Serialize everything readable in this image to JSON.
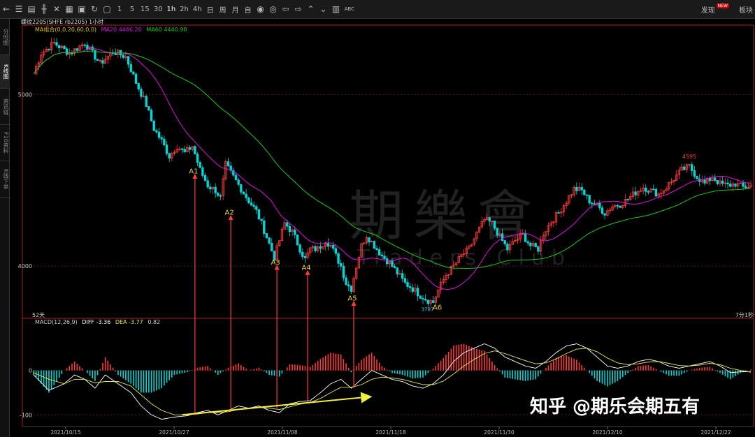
{
  "toolbar": {
    "items": [
      {
        "name": "back-icon",
        "glyph": "←"
      },
      {
        "name": "list-icon",
        "glyph": "☰"
      },
      {
        "name": "grid-icon",
        "glyph": "▤"
      },
      {
        "name": "kline-icon",
        "glyph": "╫"
      },
      {
        "name": "tools-icon",
        "glyph": "✕"
      },
      {
        "name": "calendar-icon",
        "glyph": "▦"
      },
      {
        "name": "save-icon",
        "glyph": "▣"
      },
      {
        "name": "refresh-icon",
        "glyph": "↻"
      },
      {
        "name": "copy-icon",
        "glyph": "▢"
      }
    ],
    "periods": [
      "1",
      "5",
      "15",
      "30",
      "1h",
      "2h",
      "4h",
      "日",
      "周",
      "月",
      "自"
    ],
    "tools": [
      {
        "name": "eye-icon",
        "glyph": "◉"
      },
      {
        "name": "eye-alt-icon",
        "glyph": "◎"
      },
      {
        "name": "arrow-left-icon",
        "glyph": "⇦"
      },
      {
        "name": "arrow-right-icon",
        "glyph": "⇨"
      },
      {
        "name": "chevron-up-icon",
        "glyph": "⌃"
      },
      {
        "name": "chevron-down-icon",
        "glyph": "⌄"
      },
      {
        "name": "layout-icon",
        "glyph": "▥"
      }
    ],
    "abc_label": "ABC",
    "discover_label": "发现",
    "new_badge": "NEW",
    "sector_label": "板块"
  },
  "sidebar": {
    "tabs": [
      "分时图",
      "K线图",
      "资讯链",
      "F10资料",
      "K线下单"
    ],
    "active": 1
  },
  "chart_header": {
    "symbol_line": "螺纹2205(SHFE rb2205) 1小时",
    "ma_label": "MA组合(0,0,20,60,0,0)",
    "ma20_label": "MA20 4466.20",
    "ma60_label": "MA60 4440.98"
  },
  "macd_header": {
    "label": "MACD(12,26,9)",
    "diff": "DIFF -3.36",
    "dea": "DEA -3.77",
    "macd": "0.82"
  },
  "markers": {
    "high_label": "4595",
    "low_label": "3787",
    "period_left": "52天",
    "countdown": "7分1秒"
  },
  "watermark": {
    "cn": "期樂會",
    "en": "Traders Club"
  },
  "footer": {
    "text": "知乎 @期乐会期五有"
  },
  "colors": {
    "up": "#ff3b3b",
    "down": "#00d8d8",
    "ma20": "#e010e0",
    "ma60": "#19c819",
    "diff": "#ffffff",
    "dea": "#e8e850",
    "annotation": "#f0d020",
    "arrow": "#ff3b3b",
    "trend": "#f0f040",
    "border": "#aa2222"
  },
  "chart_data": [
    {
      "type": "candlestick",
      "title": "螺纹2205(SHFE rb2205) 1小时",
      "ylim": [
        3700,
        5400
      ],
      "yticks": [
        4000,
        5000
      ],
      "xlabels": [
        "2021/10/15",
        "2021/10/27",
        "2021/11/08",
        "2021/11/18",
        "2021/11/30",
        "2021/12/10",
        "2021/12/22"
      ],
      "price_path": [
        [
          0,
          5120
        ],
        [
          3,
          5240
        ],
        [
          8,
          5300
        ],
        [
          14,
          5240
        ],
        [
          20,
          5300
        ],
        [
          26,
          5180
        ],
        [
          31,
          5250
        ],
        [
          36,
          5220
        ],
        [
          40,
          5070
        ],
        [
          44,
          4940
        ],
        [
          47,
          4800
        ],
        [
          50,
          4730
        ],
        [
          53,
          4640
        ],
        [
          56,
          4700
        ],
        [
          59,
          4660
        ],
        [
          62,
          4700
        ],
        [
          65,
          4560
        ],
        [
          68,
          4470
        ],
        [
          71,
          4440
        ],
        [
          73,
          4400
        ],
        [
          75,
          4590
        ],
        [
          78,
          4520
        ],
        [
          81,
          4450
        ],
        [
          84,
          4380
        ],
        [
          87,
          4320
        ],
        [
          90,
          4210
        ],
        [
          92,
          4130
        ],
        [
          94,
          4050
        ],
        [
          96,
          4150
        ],
        [
          98,
          4250
        ],
        [
          101,
          4200
        ],
        [
          104,
          4100
        ],
        [
          106,
          4040
        ],
        [
          108,
          4100
        ],
        [
          111,
          4100
        ],
        [
          114,
          4150
        ],
        [
          116,
          4120
        ],
        [
          118,
          4060
        ],
        [
          120,
          4000
        ],
        [
          122,
          3900
        ],
        [
          124,
          3870
        ],
        [
          126,
          4000
        ],
        [
          128,
          4120
        ],
        [
          130,
          4180
        ],
        [
          133,
          4120
        ],
        [
          136,
          4060
        ],
        [
          139,
          4020
        ],
        [
          142,
          3960
        ],
        [
          145,
          3900
        ],
        [
          148,
          3870
        ],
        [
          151,
          3830
        ],
        [
          154,
          3800
        ],
        [
          156,
          3790
        ],
        [
          158,
          3860
        ],
        [
          161,
          3950
        ],
        [
          164,
          4000
        ],
        [
          167,
          4060
        ],
        [
          170,
          4100
        ],
        [
          173,
          4190
        ],
        [
          176,
          4270
        ],
        [
          179,
          4250
        ],
        [
          182,
          4170
        ],
        [
          185,
          4100
        ],
        [
          188,
          4150
        ],
        [
          191,
          4180
        ],
        [
          194,
          4120
        ],
        [
          197,
          4100
        ],
        [
          199,
          4190
        ],
        [
          202,
          4260
        ],
        [
          205,
          4310
        ],
        [
          208,
          4380
        ],
        [
          211,
          4450
        ],
        [
          214,
          4440
        ],
        [
          217,
          4380
        ],
        [
          220,
          4350
        ],
        [
          223,
          4310
        ],
        [
          226,
          4350
        ],
        [
          229,
          4360
        ],
        [
          232,
          4390
        ],
        [
          235,
          4430
        ],
        [
          238,
          4460
        ],
        [
          241,
          4440
        ],
        [
          244,
          4420
        ],
        [
          247,
          4460
        ],
        [
          250,
          4510
        ],
        [
          253,
          4560
        ],
        [
          256,
          4580
        ],
        [
          259,
          4520
        ],
        [
          262,
          4480
        ],
        [
          265,
          4520
        ],
        [
          268,
          4480
        ],
        [
          271,
          4470
        ],
        [
          274,
          4480
        ],
        [
          277,
          4460
        ],
        [
          280,
          4470
        ]
      ],
      "annotations": [
        {
          "label": "A1",
          "x": 63,
          "price": 4580,
          "macd": -98
        },
        {
          "label": "A2",
          "x": 77,
          "price": 4340,
          "macd": -92
        },
        {
          "label": "A3",
          "x": 95,
          "price": 4050,
          "macd": -87
        },
        {
          "label": "A4",
          "x": 107,
          "price": 4020,
          "macd": -73
        },
        {
          "label": "A5",
          "x": 125,
          "price": 3840,
          "macd": -40
        },
        {
          "label": "A6",
          "x": 156,
          "price": 3787,
          "macd": null
        }
      ],
      "high": {
        "label": "4595",
        "x": 256,
        "price": 4595
      },
      "low": {
        "label": "3787",
        "x": 156,
        "price": 3787
      }
    },
    {
      "type": "macd",
      "title": "MACD(12,26,9)",
      "ylim": [
        -120,
        100
      ],
      "yticks": [
        0,
        -100
      ],
      "trendline": {
        "x1": 58,
        "y1": -100,
        "x2": 130,
        "y2": -60
      },
      "diff_path": [
        [
          0,
          -10
        ],
        [
          6,
          -45
        ],
        [
          12,
          -30
        ],
        [
          16,
          -10
        ],
        [
          20,
          -20
        ],
        [
          24,
          -40
        ],
        [
          28,
          -10
        ],
        [
          33,
          -30
        ],
        [
          38,
          -50
        ],
        [
          42,
          -80
        ],
        [
          46,
          -100
        ],
        [
          50,
          -110
        ],
        [
          55,
          -105
        ],
        [
          60,
          -102
        ],
        [
          64,
          -95
        ],
        [
          68,
          -90
        ],
        [
          72,
          -100
        ],
        [
          76,
          -90
        ],
        [
          80,
          -80
        ],
        [
          84,
          -85
        ],
        [
          88,
          -80
        ],
        [
          92,
          -90
        ],
        [
          96,
          -95
        ],
        [
          100,
          -75
        ],
        [
          104,
          -70
        ],
        [
          108,
          -68
        ],
        [
          112,
          -50
        ],
        [
          116,
          -30
        ],
        [
          120,
          -20
        ],
        [
          124,
          -40
        ],
        [
          128,
          -20
        ],
        [
          132,
          0
        ],
        [
          136,
          -10
        ],
        [
          140,
          -20
        ],
        [
          144,
          -25
        ],
        [
          148,
          -35
        ],
        [
          152,
          -40
        ],
        [
          156,
          -30
        ],
        [
          160,
          -10
        ],
        [
          164,
          20
        ],
        [
          168,
          40
        ],
        [
          172,
          50
        ],
        [
          176,
          60
        ],
        [
          180,
          50
        ],
        [
          184,
          30
        ],
        [
          188,
          20
        ],
        [
          192,
          10
        ],
        [
          196,
          5
        ],
        [
          200,
          20
        ],
        [
          204,
          40
        ],
        [
          208,
          55
        ],
        [
          212,
          60
        ],
        [
          216,
          50
        ],
        [
          220,
          30
        ],
        [
          224,
          10
        ],
        [
          228,
          5
        ],
        [
          232,
          10
        ],
        [
          236,
          20
        ],
        [
          240,
          25
        ],
        [
          244,
          20
        ],
        [
          248,
          10
        ],
        [
          252,
          5
        ],
        [
          256,
          10
        ],
        [
          260,
          15
        ],
        [
          264,
          20
        ],
        [
          268,
          10
        ],
        [
          272,
          -5
        ],
        [
          276,
          -3
        ],
        [
          280,
          -3
        ]
      ],
      "dea_path": [
        [
          0,
          -5
        ],
        [
          6,
          -20
        ],
        [
          12,
          -30
        ],
        [
          16,
          -20
        ],
        [
          20,
          -20
        ],
        [
          24,
          -28
        ],
        [
          28,
          -25
        ],
        [
          33,
          -25
        ],
        [
          38,
          -35
        ],
        [
          42,
          -55
        ],
        [
          46,
          -75
        ],
        [
          50,
          -90
        ],
        [
          55,
          -100
        ],
        [
          60,
          -100
        ],
        [
          64,
          -98
        ],
        [
          68,
          -95
        ],
        [
          72,
          -95
        ],
        [
          76,
          -93
        ],
        [
          80,
          -88
        ],
        [
          84,
          -85
        ],
        [
          88,
          -83
        ],
        [
          92,
          -85
        ],
        [
          96,
          -88
        ],
        [
          100,
          -82
        ],
        [
          104,
          -76
        ],
        [
          108,
          -72
        ],
        [
          112,
          -63
        ],
        [
          116,
          -50
        ],
        [
          120,
          -38
        ],
        [
          124,
          -38
        ],
        [
          128,
          -32
        ],
        [
          132,
          -20
        ],
        [
          136,
          -15
        ],
        [
          140,
          -17
        ],
        [
          144,
          -20
        ],
        [
          148,
          -26
        ],
        [
          152,
          -32
        ],
        [
          156,
          -32
        ],
        [
          160,
          -24
        ],
        [
          164,
          -8
        ],
        [
          168,
          10
        ],
        [
          172,
          25
        ],
        [
          176,
          38
        ],
        [
          180,
          44
        ],
        [
          184,
          38
        ],
        [
          188,
          30
        ],
        [
          192,
          22
        ],
        [
          196,
          15
        ],
        [
          200,
          17
        ],
        [
          204,
          26
        ],
        [
          208,
          38
        ],
        [
          212,
          48
        ],
        [
          216,
          50
        ],
        [
          220,
          42
        ],
        [
          224,
          28
        ],
        [
          228,
          17
        ],
        [
          232,
          13
        ],
        [
          236,
          15
        ],
        [
          240,
          19
        ],
        [
          244,
          20
        ],
        [
          248,
          16
        ],
        [
          252,
          11
        ],
        [
          256,
          10
        ],
        [
          260,
          12
        ],
        [
          264,
          16
        ],
        [
          268,
          13
        ],
        [
          272,
          5
        ],
        [
          276,
          0
        ],
        [
          280,
          -4
        ]
      ]
    }
  ]
}
